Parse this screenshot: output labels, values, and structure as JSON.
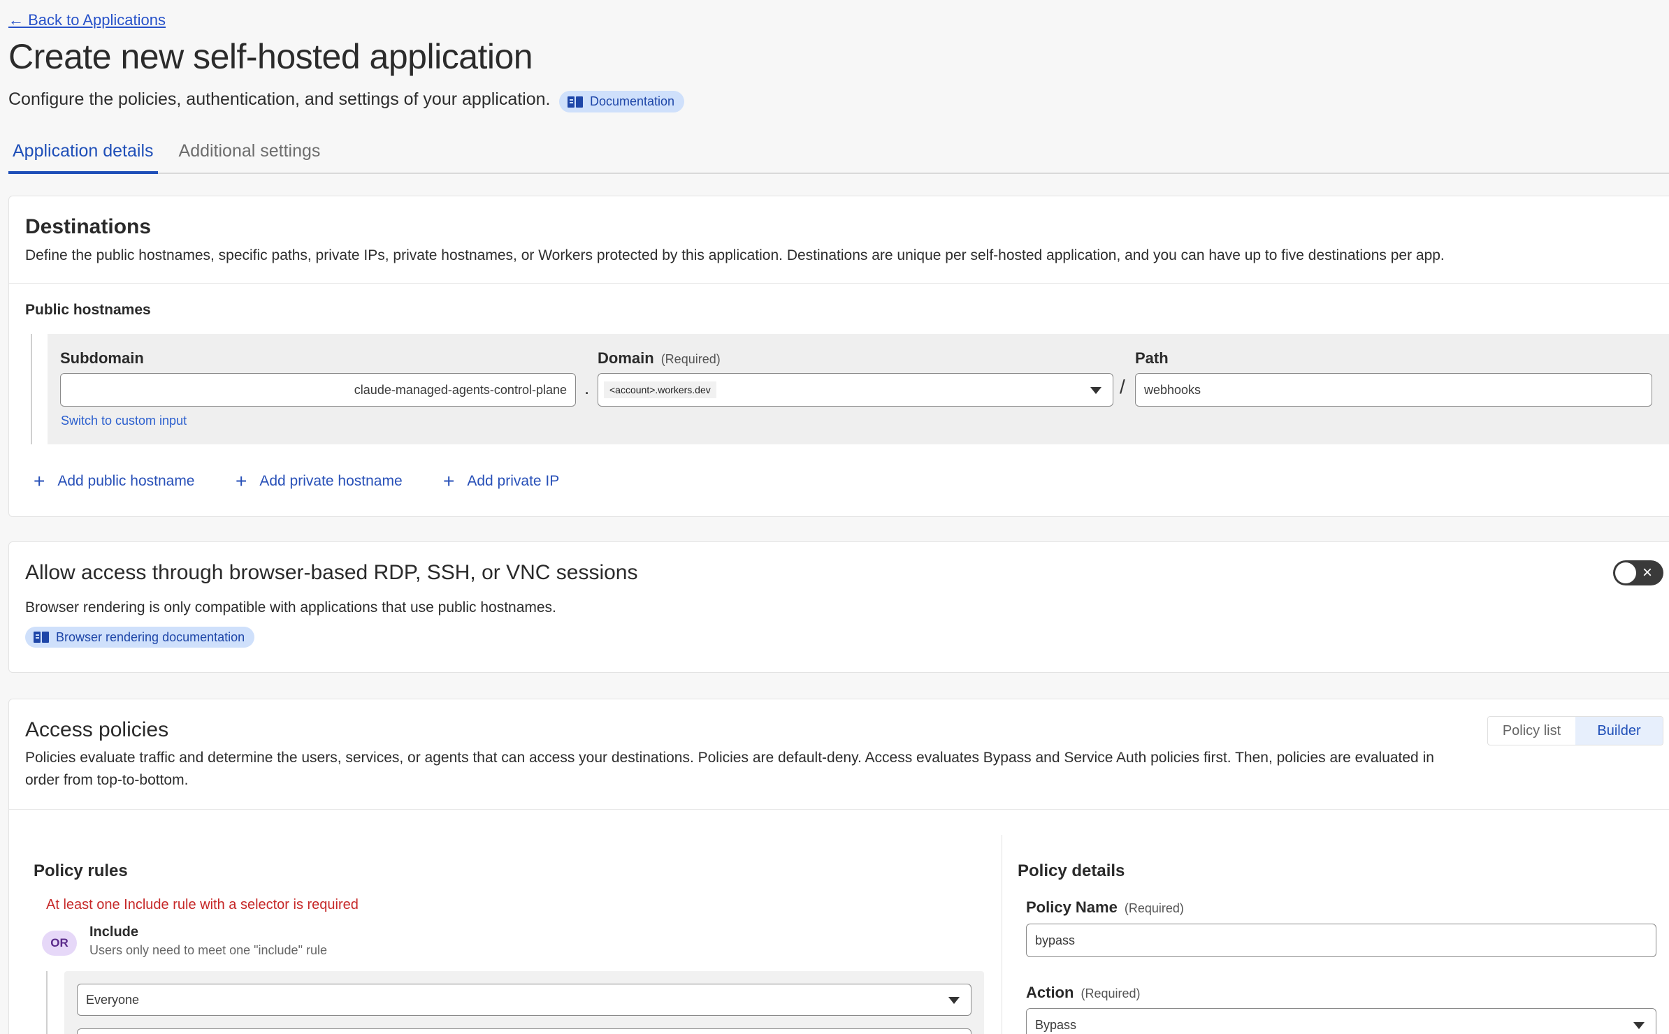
{
  "header": {
    "back_link": "← Back to Applications",
    "title": "Create new self-hosted application",
    "subtitle": "Configure the policies, authentication, and settings of your application.",
    "doc_pill": "Documentation"
  },
  "tabs": [
    {
      "label": "Application details",
      "active": true
    },
    {
      "label": "Additional settings",
      "active": false
    }
  ],
  "destinations": {
    "title": "Destinations",
    "description": "Define the public hostnames, specific paths, private IPs, private hostnames, or Workers protected by this application. Destinations are unique per self-hosted application, and you can have up to five destinations per app.",
    "public_hostnames_label": "Public hostnames",
    "subdomain_label": "Subdomain",
    "subdomain_value": "claude-managed-agents-control-plane",
    "dot_sep": ".",
    "domain_label": "Domain",
    "domain_required": "(Required)",
    "domain_value": "<account>.workers.dev",
    "slash_sep": "/",
    "path_label": "Path",
    "path_value": "webhooks",
    "switch_link": "Switch to custom input",
    "add_public": "Add public hostname",
    "add_private_hostname": "Add private hostname",
    "add_private_ip": "Add private IP"
  },
  "rdp": {
    "title": "Allow access through browser-based RDP, SSH, or VNC sessions",
    "description": "Browser rendering is only compatible with applications that use public hostnames.",
    "doc_pill": "Browser rendering documentation",
    "toggle_on": false
  },
  "access": {
    "title": "Access policies",
    "description": "Policies evaluate traffic and determine the users, services, or agents that can access your destinations. Policies are default-deny. Access evaluates Bypass and Service Auth policies first. Then, policies are evaluated in order from top-to-bottom.",
    "seg_policy_list": "Policy list",
    "seg_builder": "Builder",
    "policy_rules_title": "Policy rules",
    "error": "At least one Include rule with a selector is required",
    "or_badge": "OR",
    "include_title": "Include",
    "include_sub": "Users only need to meet one \"include\" rule",
    "include_select": "Everyone",
    "policy_details_title": "Policy details",
    "policy_name_label": "Policy Name",
    "policy_name_required": "(Required)",
    "policy_name_value": "bypass",
    "action_label": "Action",
    "action_required": "(Required)",
    "action_value": "Bypass"
  },
  "colors": {
    "accent": "#1f4fb8",
    "error": "#c62828",
    "pill_bg": "#cfe0fb"
  }
}
